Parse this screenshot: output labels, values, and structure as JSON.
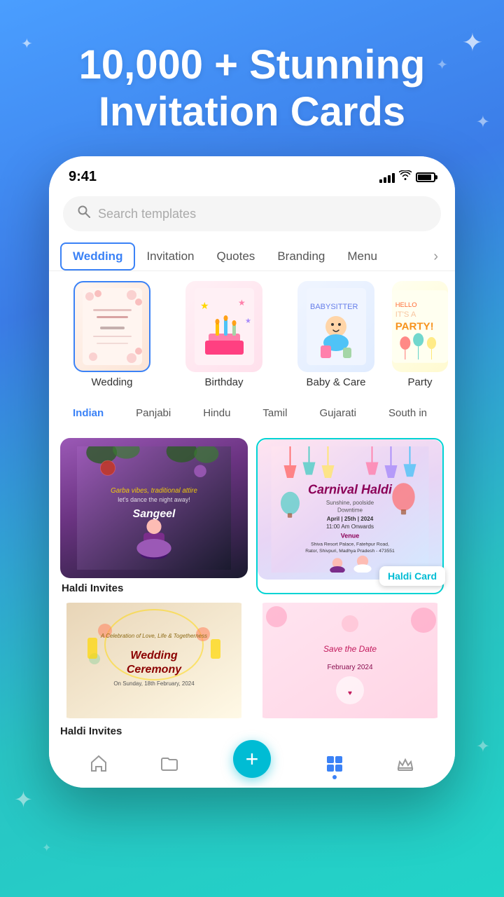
{
  "hero": {
    "title_line1": "10,000 + Stunning",
    "title_line2": "Invitation Cards"
  },
  "status_bar": {
    "time": "9:41",
    "signal": "signal",
    "wifi": "wifi",
    "battery": "battery"
  },
  "search": {
    "placeholder": "Search templates"
  },
  "category_tabs": {
    "items": [
      {
        "label": "Wedding",
        "active": true
      },
      {
        "label": "Invitation",
        "active": false
      },
      {
        "label": "Quotes",
        "active": false
      },
      {
        "label": "Branding",
        "active": false
      },
      {
        "label": "Menu",
        "active": false
      }
    ],
    "more_label": "›"
  },
  "template_icons": [
    {
      "label": "Wedding",
      "selected": true
    },
    {
      "label": "Birthday",
      "selected": false
    },
    {
      "label": "Baby & Care",
      "selected": false
    },
    {
      "label": "Party",
      "selected": false
    }
  ],
  "filter_pills": [
    {
      "label": "Indian",
      "active": true
    },
    {
      "label": "Panjabi",
      "active": false
    },
    {
      "label": "Hindu",
      "active": false
    },
    {
      "label": "Tamil",
      "active": false
    },
    {
      "label": "Gujarati",
      "active": false
    },
    {
      "label": "South in",
      "active": false
    }
  ],
  "cards": [
    {
      "id": "haldi-invites",
      "label": "Haldi Invites",
      "badge": null
    },
    {
      "id": "haldi-card",
      "label": "",
      "badge": "Haldi Card"
    },
    {
      "id": "wedding-ceremony",
      "label": "",
      "badge": null
    },
    {
      "id": "wedding-2",
      "label": "",
      "badge": null
    }
  ],
  "fab": {
    "label": "+"
  },
  "bottom_nav": {
    "items": [
      {
        "label": "home",
        "icon": "⌂",
        "active": false
      },
      {
        "label": "folder",
        "icon": "⬜",
        "active": false
      },
      {
        "label": "templates",
        "icon": "⊞",
        "active": true
      },
      {
        "label": "crown",
        "icon": "♛",
        "active": false
      }
    ]
  }
}
